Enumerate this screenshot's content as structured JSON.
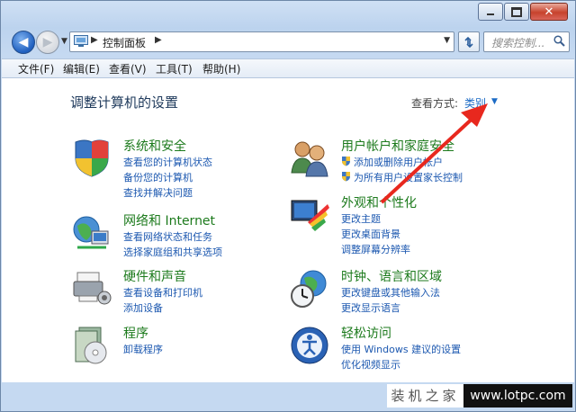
{
  "window": {
    "buttons": {
      "minimize": "minimize",
      "maximize": "maximize",
      "close": "✕"
    }
  },
  "nav": {
    "address": "控制面板",
    "search_placeholder": "搜索控制..."
  },
  "menu": [
    {
      "label": "文件(F)"
    },
    {
      "label": "编辑(E)"
    },
    {
      "label": "查看(V)"
    },
    {
      "label": "工具(T)"
    },
    {
      "label": "帮助(H)"
    }
  ],
  "content": {
    "page_title": "调整计算机的设置",
    "view_by_label": "查看方式:",
    "view_by_value": "类别",
    "categories": [
      {
        "title": "系统和安全",
        "icon": "system-security-icon",
        "links": [
          "查看您的计算机状态",
          "备份您的计算机",
          "查找并解决问题"
        ]
      },
      {
        "title": "网络和 Internet",
        "icon": "network-icon",
        "links": [
          "查看网络状态和任务",
          "选择家庭组和共享选项"
        ]
      },
      {
        "title": "硬件和声音",
        "icon": "hardware-sound-icon",
        "links": [
          "查看设备和打印机",
          "添加设备"
        ]
      },
      {
        "title": "程序",
        "icon": "programs-icon",
        "links": [
          "卸载程序"
        ]
      },
      {
        "title": "用户帐户和家庭安全",
        "icon": "user-accounts-icon",
        "links": [
          "添加或删除用户帐户",
          "为所有用户设置家长控制"
        ]
      },
      {
        "title": "外观和个性化",
        "icon": "appearance-icon",
        "links": [
          "更改主题",
          "更改桌面背景",
          "调整屏幕分辨率"
        ]
      },
      {
        "title": "时钟、语言和区域",
        "icon": "clock-language-icon",
        "links": [
          "更改键盘或其他输入法",
          "更改显示语言"
        ]
      },
      {
        "title": "轻松访问",
        "icon": "ease-of-access-icon",
        "links": [
          "使用 Windows 建议的设置",
          "优化视频显示"
        ]
      }
    ]
  },
  "watermark": {
    "left": "装机之家",
    "right": "www.lotpc.com"
  },
  "colors": {
    "accent_green": "#1c7a1c",
    "link_blue": "#1c58b0",
    "title_blue": "#1e395b",
    "arrow_red": "#e8281e"
  }
}
